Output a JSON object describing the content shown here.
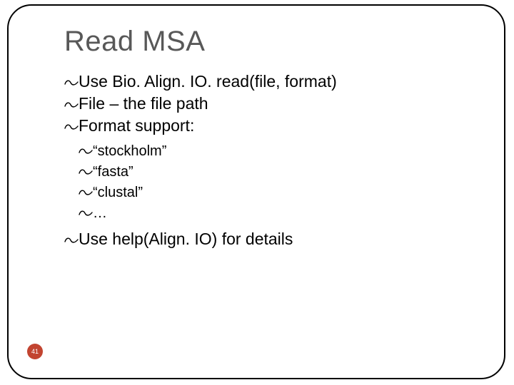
{
  "slide": {
    "title": "Read MSA",
    "bullet_glyph": "་",
    "items_l1_a": [
      "Use Bio. Align. IO. read(file, format)",
      "File – the file path",
      "Format support:"
    ],
    "items_l2": [
      "“stockholm”",
      "“fasta”",
      "“clustal”",
      "…"
    ],
    "items_l1_b": [
      "Use help(Align. IO) for details"
    ],
    "page_number": "41"
  }
}
